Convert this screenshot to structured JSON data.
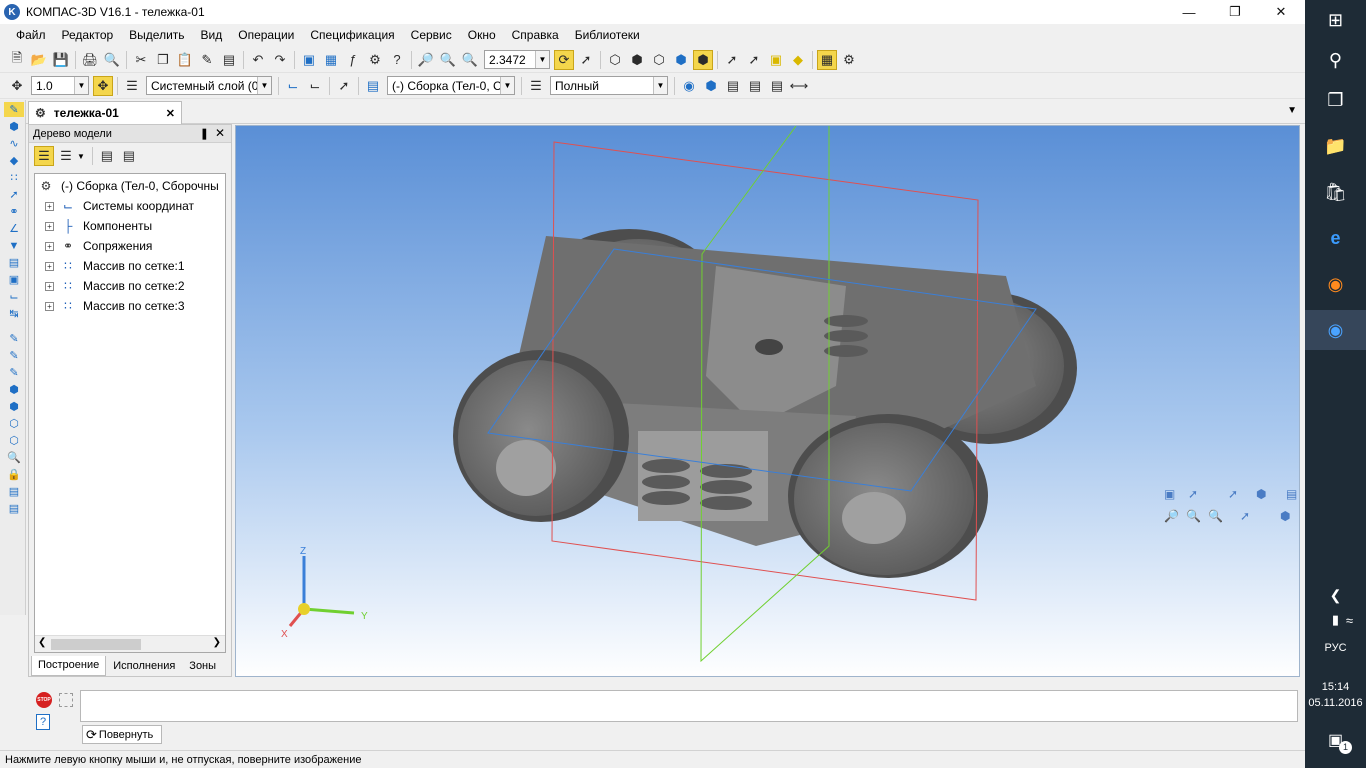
{
  "window": {
    "title": "КОМПАС-3D V16.1 - тележка-01",
    "logo": "K"
  },
  "menu": [
    "Файл",
    "Редактор",
    "Выделить",
    "Вид",
    "Операции",
    "Спецификация",
    "Сервис",
    "Окно",
    "Справка",
    "Библиотеки"
  ],
  "toolbar1": {
    "zoom_value": "2.3472"
  },
  "toolbar2": {
    "step_value": "1.0",
    "layer": "Системный слой (0)",
    "context": "(-) Сборка (Тел-0, С",
    "display_mode": "Полный"
  },
  "document_tab": {
    "label": "тележка-01",
    "close": "✕"
  },
  "tree_panel": {
    "title": "Дерево модели",
    "root": "(-) Сборка (Тел-0, Сборочны",
    "items": [
      {
        "label": "Системы координат",
        "icon": "coordinate-systems-icon"
      },
      {
        "label": "Компоненты",
        "icon": "components-icon"
      },
      {
        "label": "Сопряжения",
        "icon": "mates-icon"
      },
      {
        "label": "Массив по сетке:1",
        "icon": "grid-array-icon"
      },
      {
        "label": "Массив по сетке:2",
        "icon": "grid-array-icon"
      },
      {
        "label": "Массив по сетке:3",
        "icon": "grid-array-icon"
      }
    ],
    "tabs": [
      "Построение",
      "Исполнения",
      "Зоны"
    ]
  },
  "axes": {
    "z": "Z",
    "y": "Y",
    "x": "X"
  },
  "status": {
    "rotate_button": "Повернуть",
    "hint": "Нажмите левую кнопку мыши и, не отпуская, поверните изображение",
    "stop": "STOP"
  },
  "taskbar": {
    "lang": "РУС",
    "time": "15:14",
    "date": "05.11.2016",
    "notifications": "1"
  },
  "colors": {
    "viewport_top": "#5a8fd6",
    "viewport_bottom": "#ffffff",
    "plane_red": "#e05050",
    "plane_green": "#70d030",
    "plane_blue": "#3a7fd8",
    "accent_blue": "#1f6fc5"
  }
}
